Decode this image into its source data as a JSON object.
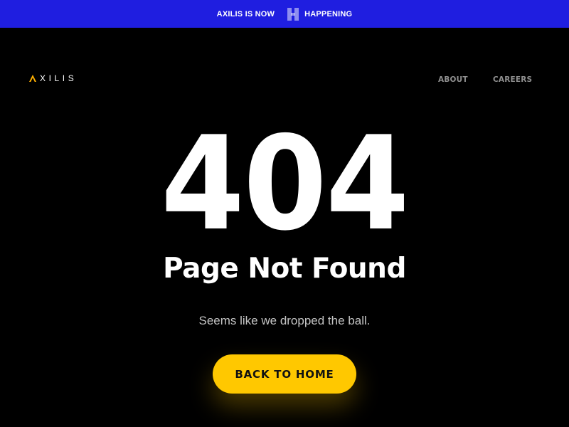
{
  "banner": {
    "text_before": "AXILIS IS NOW",
    "text_after": "HAPPENING",
    "background_color": "#1f1ee0",
    "icon": "happening-h-logo-icon"
  },
  "header": {
    "logo_text": "XILIS",
    "logo_mark_color": "#ffb000",
    "logo_mark_icon": "axilis-a-mark-icon",
    "nav": [
      {
        "label": "ABOUT"
      },
      {
        "label": "CAREERS"
      }
    ]
  },
  "main": {
    "error_code": "404",
    "title": "Page Not Found",
    "subtitle": "Seems like we dropped the ball.",
    "cta_label": "BACK TO HOME",
    "cta_color": "#ffc800"
  }
}
